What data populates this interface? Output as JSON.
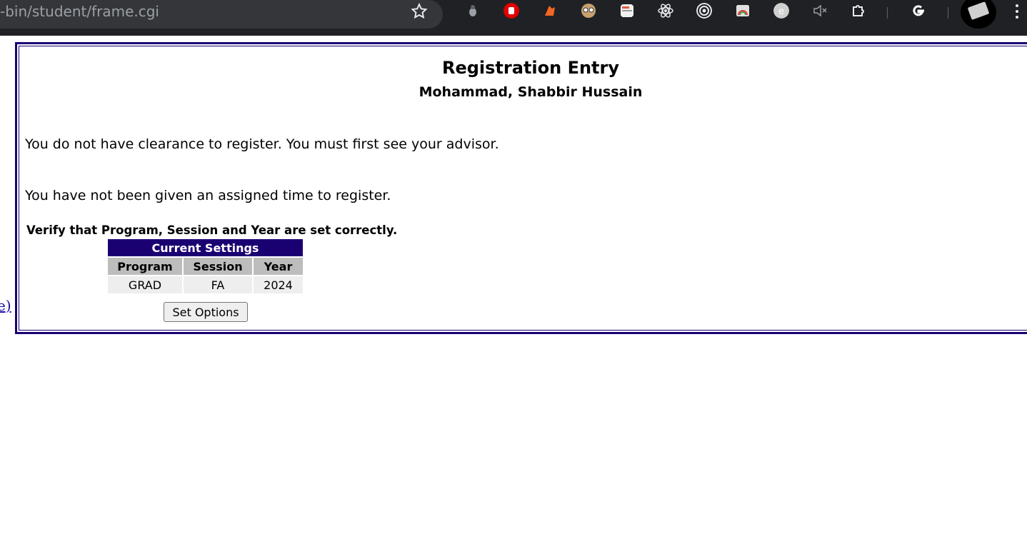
{
  "browser": {
    "url_fragment": "-bin/student/frame.cgi",
    "extensions": [
      {
        "name": "ladybug-extension-icon",
        "color": "#9aa0a6"
      },
      {
        "name": "adblock-hand-icon",
        "color": "#e00000"
      },
      {
        "name": "orange-hand-extension-icon",
        "color": "#f26522"
      },
      {
        "name": "goggles-extension-icon",
        "color": "#c8a070"
      },
      {
        "name": "notes-extension-icon",
        "color": "#f0f0f0"
      },
      {
        "name": "react-devtools-icon",
        "color": "#e8eaed"
      },
      {
        "name": "target-extension-icon",
        "color": "#e8eaed"
      },
      {
        "name": "rainbow-extension-icon",
        "color": "#e0e0e0"
      },
      {
        "name": "circle-e-extension-icon",
        "color": "#cfcfcf"
      },
      {
        "name": "muted-speaker-icon",
        "color": "#9aa0a6"
      },
      {
        "name": "puzzle-extensions-icon",
        "color": "#e8eaed"
      },
      {
        "name": "google-g-icon",
        "color": "#ffffff"
      }
    ]
  },
  "left_link_fragment": "e)",
  "page": {
    "title": "Registration Entry",
    "student_name": "Mohammad, Shabbir Hussain",
    "message_clearance": "You do not have clearance to register. You must first see your advisor.",
    "message_time": "You have not been given an assigned time to register.",
    "verify_text": "Verify that Program, Session and Year are set correctly."
  },
  "settings_table": {
    "caption": "Current Settings",
    "headers": [
      "Program",
      "Session",
      "Year"
    ],
    "values": [
      "GRAD",
      "FA",
      "2024"
    ]
  },
  "set_options_button": "Set Options",
  "colors": {
    "frame_border": "#1b0072",
    "table_caption_bg": "#1b0072",
    "table_header_bg": "#bdbdbd",
    "table_cell_bg": "#eeeeee"
  }
}
